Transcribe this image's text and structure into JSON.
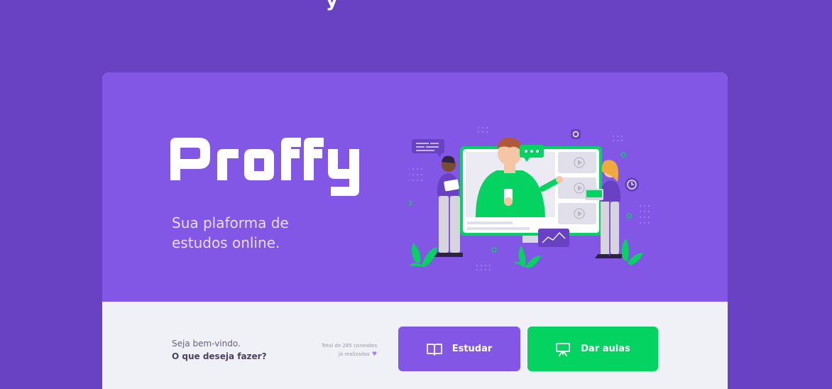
{
  "brand": {
    "name": "Proffy",
    "tagline": "Sua plaforma de estudos online.",
    "top_glyph": "y"
  },
  "footer": {
    "welcome_line": "Seja bem-vindo.",
    "question_line": "O que deseja fazer?",
    "connections_line1": "Total de 285 conexões",
    "connections_line2": "já realizadas"
  },
  "actions": {
    "study_label": "Estudar",
    "teach_label": "Dar aulas"
  },
  "icons": {
    "study": "book-open-icon",
    "teach": "presentation-board-icon",
    "connections": "heart-icon"
  },
  "colors": {
    "page_bg": "#6842C2",
    "hero_bg": "#8257E5",
    "footer_bg": "#F0F0F7",
    "primary": "#8257E5",
    "secondary": "#04D361"
  }
}
